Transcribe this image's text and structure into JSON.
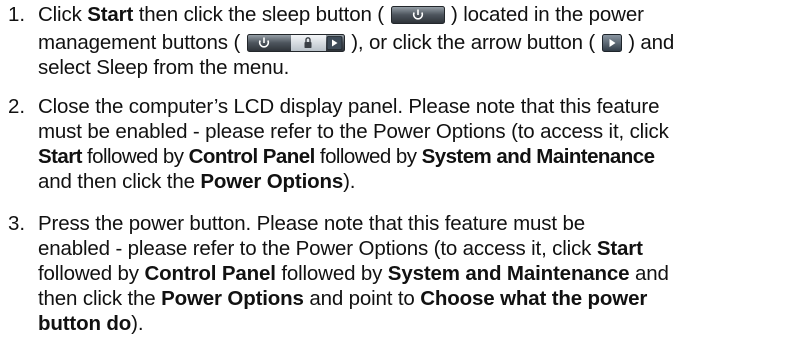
{
  "steps": [
    {
      "number": "1.",
      "parts": {
        "a": "Click",
        "start": "Start",
        "b": "then click the sleep button (",
        "c": ") located in the power",
        "d": "management buttons (",
        "e": "), or click the arrow button (",
        "f": ") and",
        "g": "select Sleep from the menu."
      }
    },
    {
      "number": "2.",
      "lines": [
        "Close the computer’s LCD display panel. Please note that this feature",
        "must be enabled - please refer to the Power Options (to access it, click"
      ],
      "parts": {
        "start": "Start",
        "followed1": "followed by",
        "control_panel": "Control Panel",
        "followed2": "followed by",
        "system": "System and Maintenance",
        "and_then": "and then click the",
        "power_options": "Power Options",
        "end": ")."
      }
    },
    {
      "number": "3.",
      "lines": [
        "Press the power button. Please note that this feature must be"
      ],
      "parts": {
        "l2a": "enabled - please refer to the Power Options (to access it, click",
        "start": "Start",
        "followed1": "followed by",
        "control_panel": "Control Panel",
        "followed2": "followed by",
        "system": "System and Maintenance",
        "and": "and",
        "then_click": "then click the",
        "power_options": "Power Options",
        "point_to": "and point to",
        "choose": "Choose what the power",
        "button_do": "button do",
        "end": ")."
      }
    }
  ],
  "icons": {
    "sleep_button": "power-sleep-icon",
    "management_buttons": "power-management-buttons-icon",
    "arrow_button": "arrow-right-icon"
  },
  "colors": {
    "button_dark": "#3a3f45",
    "button_light": "#e8ecef",
    "glyph": "#ffffff"
  }
}
